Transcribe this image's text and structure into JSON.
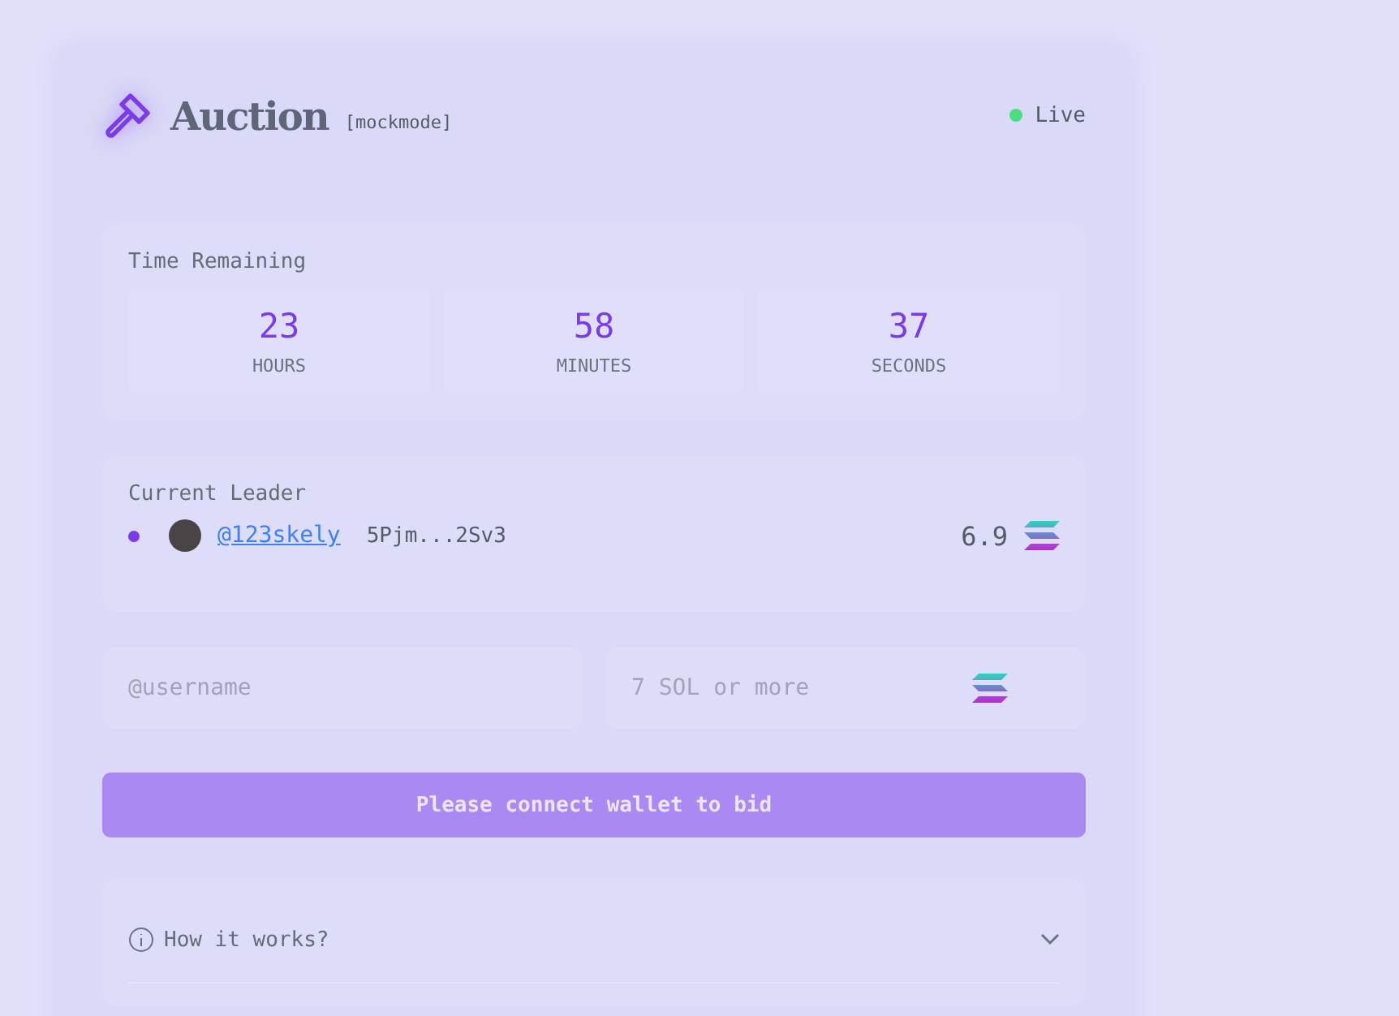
{
  "header": {
    "title": "Auction",
    "mode": "[mockmode]",
    "status": {
      "label": "Live",
      "live": true
    }
  },
  "timer": {
    "title": "Time Remaining",
    "units": [
      {
        "value": "23",
        "label": "HOURS"
      },
      {
        "value": "58",
        "label": "MINUTES"
      },
      {
        "value": "37",
        "label": "SECONDS"
      }
    ]
  },
  "leader": {
    "title": "Current Leader",
    "username": "@123skely",
    "wallet": "5Pjm...2Sv3",
    "amount": "6.9"
  },
  "bid_form": {
    "username": {
      "placeholder": "@username"
    },
    "amount": {
      "placeholder": "7 SOL or more"
    },
    "button": {
      "label": "Please connect wallet to bid",
      "disabled": true
    }
  },
  "faq": {
    "title": "How it works?",
    "expanded": false
  }
}
